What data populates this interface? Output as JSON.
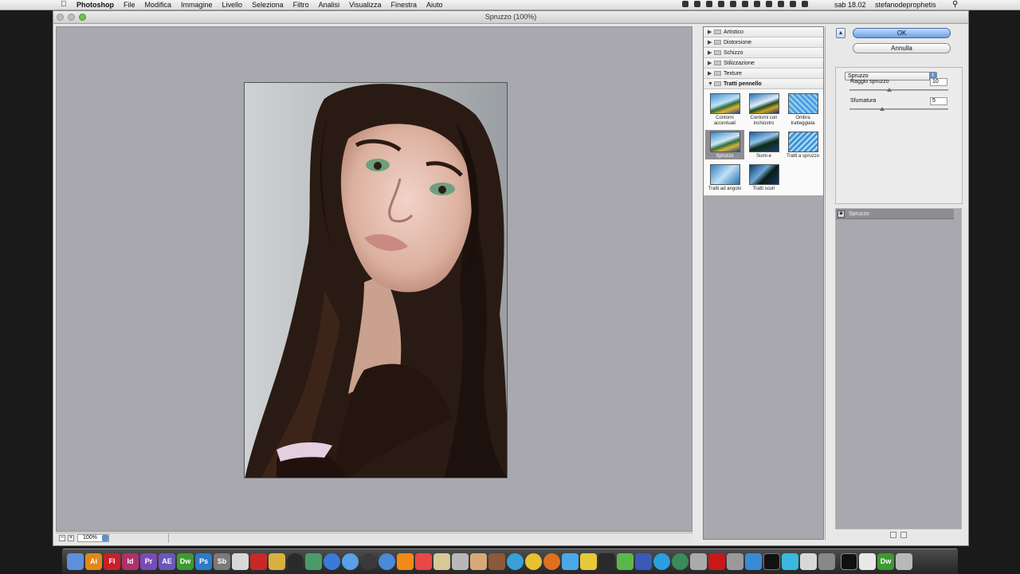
{
  "menubar": {
    "app_name": "Photoshop",
    "menus": [
      "File",
      "Modifica",
      "Immagine",
      "Livello",
      "Seleziona",
      "Filtro",
      "Analisi",
      "Visualizza",
      "Finestra",
      "Aiuto"
    ],
    "clock": "sab 18.02",
    "user": "stefanodeprophetis"
  },
  "window": {
    "title": "Spruzzo (100%)"
  },
  "preview": {
    "zoom_value": "100%"
  },
  "gallery": {
    "categories": [
      {
        "label": "Artistico",
        "open": false
      },
      {
        "label": "Distorsione",
        "open": false
      },
      {
        "label": "Schizzo",
        "open": false
      },
      {
        "label": "Stilizzazione",
        "open": false
      },
      {
        "label": "Texture",
        "open": false
      },
      {
        "label": "Tratti pennello",
        "open": true
      }
    ],
    "thumbnails": [
      {
        "label": "Contorni accentuati",
        "selected": false
      },
      {
        "label": "Contorni con inchiostro",
        "selected": false
      },
      {
        "label": "Ombra tratteggiata",
        "selected": false
      },
      {
        "label": "Spruzzo",
        "selected": true
      },
      {
        "label": "Sumi-e",
        "selected": false
      },
      {
        "label": "Tratti a spruzzo",
        "selected": false
      },
      {
        "label": "Tratti ad angolo",
        "selected": false
      },
      {
        "label": "Tratti scuri",
        "selected": false
      }
    ]
  },
  "panel": {
    "ok_label": "OK",
    "cancel_label": "Annulla",
    "filter_selected": "Spruzzo",
    "params": [
      {
        "label": "Raggio spruzzo",
        "value": "10",
        "level": 0.4
      },
      {
        "label": "Sfumatura",
        "value": "5",
        "level": 0.33
      }
    ]
  },
  "layers": {
    "items": [
      {
        "label": "Spruzzo"
      }
    ]
  },
  "dock": {
    "labels": [
      "Ai",
      "Fl",
      "Id",
      "Pr",
      "AE",
      "Dw",
      "Ps",
      "Sb",
      "Dw"
    ]
  },
  "colors": {
    "canvas": "#a9a8ae",
    "selection": "#8e8d93",
    "ok_blue": "#6a9fe6"
  }
}
